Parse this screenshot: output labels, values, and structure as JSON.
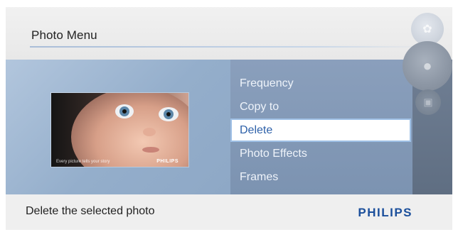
{
  "header": {
    "title": "Photo Menu"
  },
  "preview": {
    "caption": "Every picture tells your story",
    "brand": "PHILIPS"
  },
  "menu": {
    "items": [
      "Frequency",
      "Copy to",
      "Delete",
      "Photo Effects",
      "Frames"
    ],
    "selected_index": 2
  },
  "footer": {
    "hint": "Delete the selected photo",
    "brand": "PHILIPS"
  },
  "colors": {
    "brand_blue": "#1b4f9b",
    "selection_text": "#2e61a9",
    "menu_background": "#8a9fbc"
  },
  "icons": [
    "control-wheel-top-icon",
    "control-wheel-center-icon",
    "control-wheel-bottom-icon"
  ]
}
